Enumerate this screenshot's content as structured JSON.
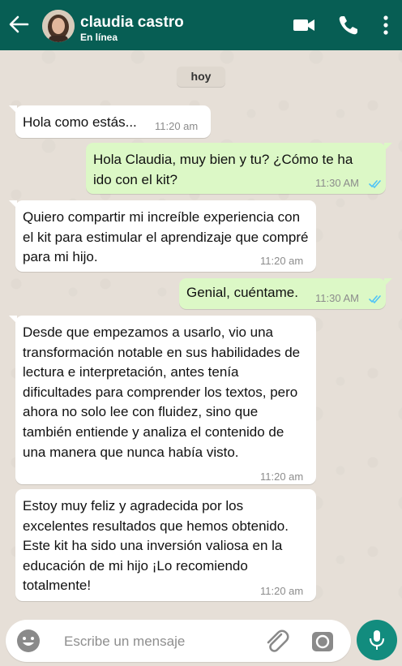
{
  "header": {
    "back_icon": "arrow-left-icon",
    "contact_name": "claudia castro",
    "status": "En línea",
    "icons": [
      "video-call-icon",
      "phone-call-icon",
      "more-vertical-icon"
    ],
    "color": "#075e54"
  },
  "date_label": "hoy",
  "messages": [
    {
      "dir": "in",
      "text": "Hola como estás...",
      "time": "11:20 am"
    },
    {
      "dir": "out",
      "text": "Hola Claudia, muy bien y tu? ¿Cómo te ha ido con el kit?",
      "time": "11:30 AM",
      "read": true
    },
    {
      "dir": "in",
      "text": "Quiero compartir mi increíble experiencia con el kit para estimular el aprendizaje que compré para mi hijo.",
      "time": "11:20 am"
    },
    {
      "dir": "out",
      "text": "Genial, cuéntame.",
      "time": "11:30 AM",
      "read": true
    },
    {
      "dir": "in",
      "text": "Desde que empezamos a usarlo, vio una transformación notable en sus habilidades de lectura e interpretación, antes tenía dificultades para comprender los textos, pero ahora no solo lee con fluidez, sino que también entiende y analiza el contenido de una manera que nunca había visto.",
      "time": "11:20 am"
    },
    {
      "dir": "in",
      "text": "Estoy muy feliz y agradecida por los excelentes resultados que hemos obtenido. Este kit ha sido una inversión valiosa en la educación de mi hijo ¡Lo recomiendo totalmente!",
      "time": "11:20 am"
    }
  ],
  "composer": {
    "placeholder": "Escribe un mensaje",
    "icons": [
      "emoji-icon",
      "attach-clip-icon",
      "camera-icon",
      "microphone-icon"
    ],
    "mic_color": "#128c7e"
  },
  "colors": {
    "incoming_bubble": "#ffffff",
    "outgoing_bubble": "#dcf8c6",
    "read_ticks": "#4fc3f7"
  }
}
